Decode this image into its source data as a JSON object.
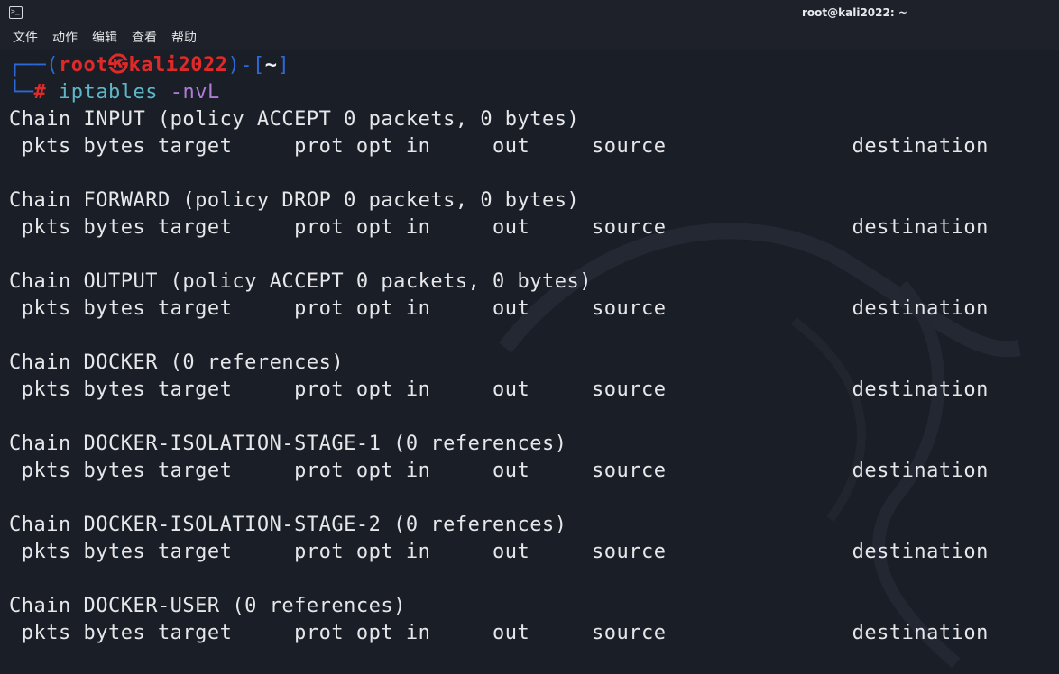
{
  "window": {
    "title": "root@kali2022: ~",
    "icon": "terminal-icon"
  },
  "menu": [
    "文件",
    "动作",
    "编辑",
    "查看",
    "帮助"
  ],
  "prompt": {
    "open_top": "┌──(",
    "user": "root",
    "at_symbol": "㉿",
    "host": "kali2022",
    "close_top": ")-[",
    "dir": "~",
    "end_top": "]",
    "corner_bottom": "└─",
    "hash": "#",
    "command_name": "iptables",
    "command_args": "-nvL"
  },
  "output": [
    "Chain INPUT (policy ACCEPT 0 packets, 0 bytes)",
    " pkts bytes target     prot opt in     out     source               destination",
    "",
    "Chain FORWARD (policy DROP 0 packets, 0 bytes)",
    " pkts bytes target     prot opt in     out     source               destination",
    "",
    "Chain OUTPUT (policy ACCEPT 0 packets, 0 bytes)",
    " pkts bytes target     prot opt in     out     source               destination",
    "",
    "Chain DOCKER (0 references)",
    " pkts bytes target     prot opt in     out     source               destination",
    "",
    "Chain DOCKER-ISOLATION-STAGE-1 (0 references)",
    " pkts bytes target     prot opt in     out     source               destination",
    "",
    "Chain DOCKER-ISOLATION-STAGE-2 (0 references)",
    " pkts bytes target     prot opt in     out     source               destination",
    "",
    "Chain DOCKER-USER (0 references)",
    " pkts bytes target     prot opt in     out     source               destination"
  ],
  "colors": {
    "background": "#1a1e26",
    "text": "#e6e7ea",
    "prompt_frame": "#2c68d8",
    "prompt_user": "#e02a2a",
    "command": "#5fb6c9",
    "argument": "#b07ad8"
  }
}
